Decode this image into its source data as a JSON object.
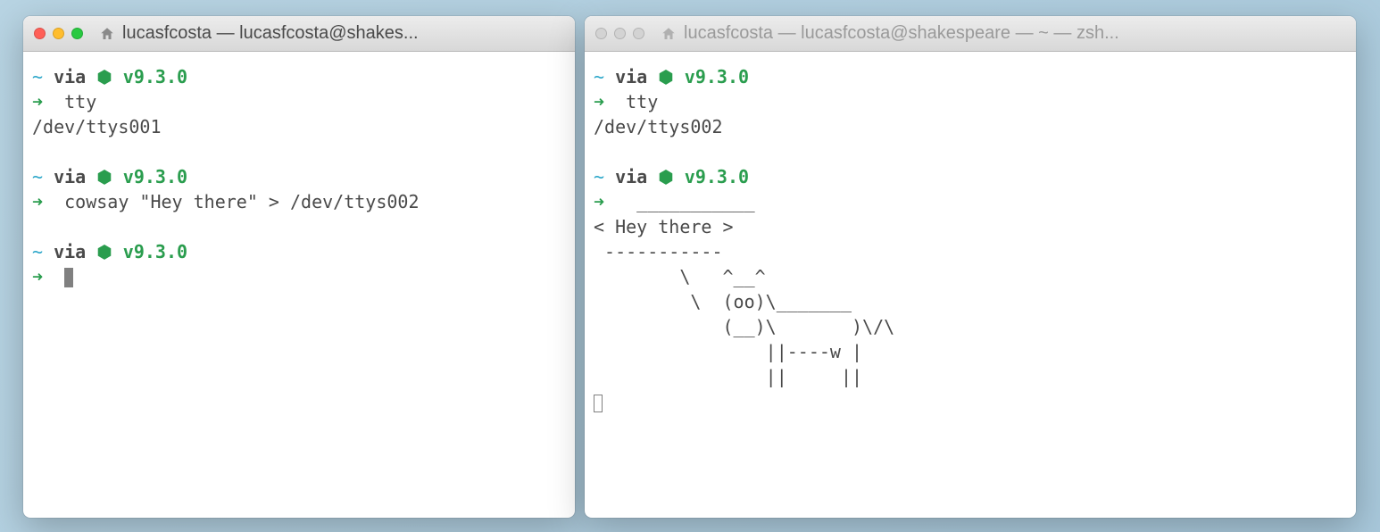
{
  "colors": {
    "cyan": "#2aa6c9",
    "green": "#2a9d4e",
    "text": "#4a4a4a"
  },
  "window_left": {
    "active": true,
    "title": "lucasfcosta — lucasfcosta@shakes...",
    "prompt": {
      "tilde": "~",
      "via": "via",
      "hex": "⬢",
      "version": "v9.3.0",
      "arrow": "➜"
    },
    "lines": [
      {
        "type": "prompt"
      },
      {
        "type": "command",
        "text": "tty"
      },
      {
        "type": "output",
        "text": "/dev/ttys001"
      },
      {
        "type": "blank"
      },
      {
        "type": "prompt"
      },
      {
        "type": "command",
        "text": "cowsay \"Hey there\" > /dev/ttys002"
      },
      {
        "type": "blank"
      },
      {
        "type": "prompt"
      },
      {
        "type": "cursor"
      }
    ]
  },
  "window_right": {
    "active": false,
    "title": "lucasfcosta — lucasfcosta@shakespeare — ~ — zsh...",
    "prompt": {
      "tilde": "~",
      "via": "via",
      "hex": "⬢",
      "version": "v9.3.0",
      "arrow": "➜"
    },
    "lines": [
      {
        "type": "prompt"
      },
      {
        "type": "command",
        "text": "tty"
      },
      {
        "type": "output",
        "text": "/dev/ttys002"
      },
      {
        "type": "blank"
      },
      {
        "type": "prompt"
      },
      {
        "type": "arrow-output",
        "text": " ___________"
      },
      {
        "type": "output",
        "text": "< Hey there >"
      },
      {
        "type": "output",
        "text": " -----------"
      },
      {
        "type": "output",
        "text": "        \\   ^__^"
      },
      {
        "type": "output",
        "text": "         \\  (oo)\\_______"
      },
      {
        "type": "output",
        "text": "            (__)\\       )\\/\\"
      },
      {
        "type": "output",
        "text": "                ||----w |"
      },
      {
        "type": "output",
        "text": "                ||     ||"
      },
      {
        "type": "cursor-outline"
      }
    ]
  }
}
